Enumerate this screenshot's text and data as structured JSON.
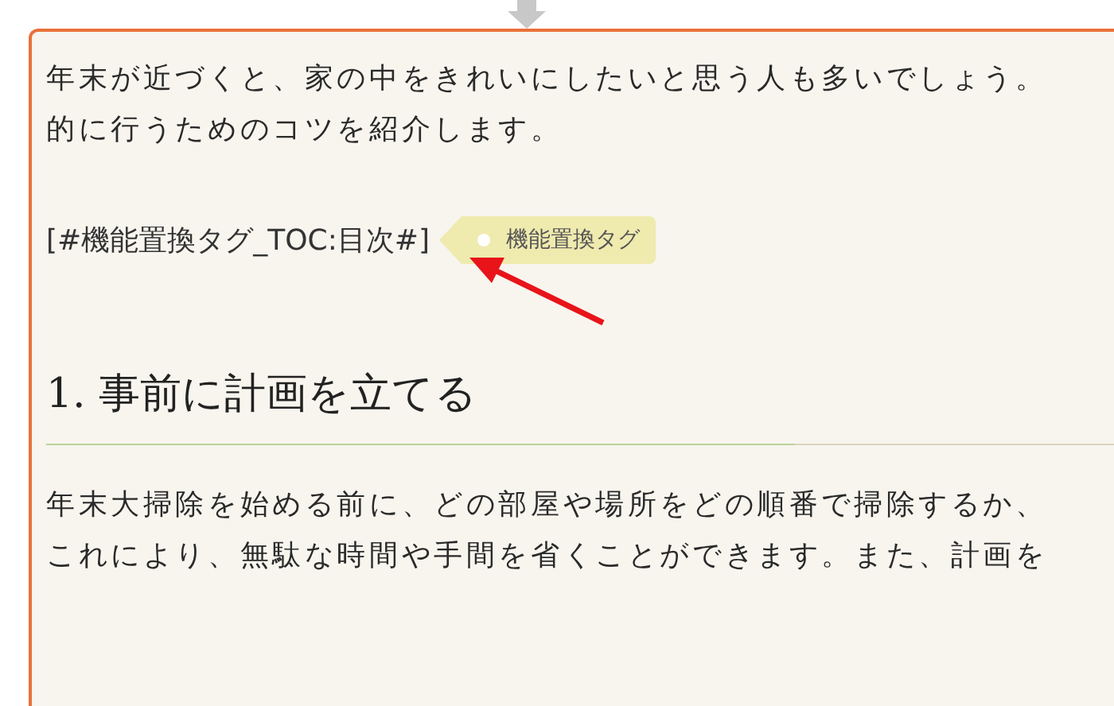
{
  "intro": [
    "年末が近づくと、家の中をきれいにしたいと思う人も多いでしょう。",
    "的に行うためのコツを紹介します。"
  ],
  "tag_line": {
    "text": "[#機能置換タグ_TOC:目次#]",
    "badge": "機能置換タグ"
  },
  "heading": "1. 事前に計画を立てる",
  "paragraph": [
    "年末大掃除を始める前に、どの部屋や場所をどの順番で掃除するか、",
    "これにより、無駄な時間や手間を省くことができます。また、計画を"
  ]
}
